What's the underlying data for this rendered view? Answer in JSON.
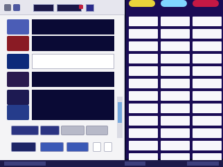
{
  "colors": {
    "panel_bg": "#f4f4f6",
    "dark_navy": "#0a0a35",
    "accent_red": "#c02040",
    "right_bg": "#1a0c55",
    "header_yellow": "#e8d23a",
    "header_cyan": "#7fd6ff",
    "header_red": "#c41844"
  },
  "toolbar": {
    "icons": [
      "app-icon",
      "link-icon"
    ]
  },
  "left_rows": [
    {
      "name": "row-1",
      "swatch": "#4b5db6"
    },
    {
      "name": "row-2",
      "swatch": "#8a1b24"
    },
    {
      "name": "row-3",
      "swatch": "#0d2a7a",
      "selected": true
    },
    {
      "name": "row-4",
      "swatch": "#2a1a4e"
    },
    {
      "name": "row-5",
      "swatch": "#1d1a52"
    },
    {
      "name": "row-6",
      "swatch": "#253c8b"
    }
  ],
  "right_columns": [
    {
      "name": "col-1",
      "header_color": "#e8d23a"
    },
    {
      "name": "col-2",
      "header_color": "#7fd6ff"
    },
    {
      "name": "col-3",
      "header_color": "#c41844"
    }
  ]
}
